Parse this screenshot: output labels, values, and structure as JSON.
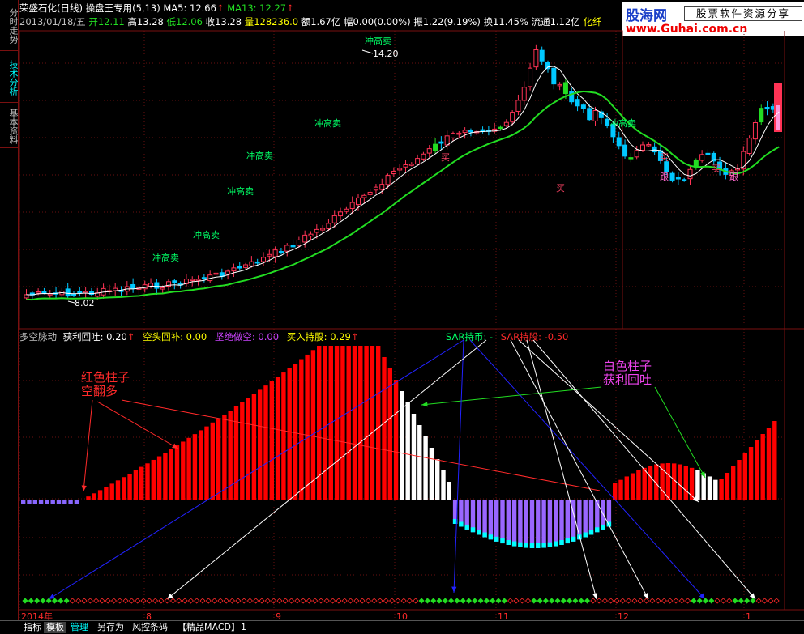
{
  "sidebar": {
    "tabs": [
      {
        "label": "分时走势",
        "active": false
      },
      {
        "label": "技术分析",
        "active": true
      },
      {
        "label": "基本资料",
        "active": false
      }
    ]
  },
  "info_bar": {
    "stock_name": "荣盛石化(日线)",
    "indicator_name": "操盘王专用(5,13)",
    "ma5": "MA5: 12.66",
    "ma13": "MA13: 12.27",
    "date": "2013/01/18/五",
    "open": "开12.11",
    "high": "高13.28",
    "low": "低12.06",
    "close": "收13.28",
    "volume": "量128236.0",
    "amount": "额1.67亿",
    "change": "幅0.00(0.00%)",
    "amplitude": "振1.22(9.19%)",
    "turnover": "换11.45%",
    "float": "流通1.12亿",
    "industry": "化纤"
  },
  "logo": {
    "brand_cn": "股海网",
    "tagline": "股票软件资源分享",
    "url": "www.Guhai.com.cn"
  },
  "main_chart": {
    "signal_buy": "买",
    "signal_sell_high": "冲高卖",
    "signal_follow": "跟",
    "high_label": "14.20",
    "low_label": "8.02",
    "colors": {
      "up": "#ff3355",
      "down": "#00c8ff",
      "ma5": "#ffffff",
      "ma13": "#22dd22",
      "signal": "#00ff66"
    }
  },
  "sub_chart": {
    "title": "多空脉动",
    "vals": [
      {
        "label": "获利回吐: 0.20",
        "color": "#ffffff"
      },
      {
        "label": "空头回补: 0.00",
        "color": "#ffff00"
      },
      {
        "label": "坚绝做空: 0.00",
        "color": "#cc44ff"
      },
      {
        "label": "买入持股: 0.29",
        "color": "#ffff00"
      }
    ],
    "sar_label": "SAR持币: -",
    "sar_hold": "SAR持股: -0.50",
    "annotation_red": [
      "红色柱子",
      "空翻多"
    ],
    "annotation_white": [
      "白色柱子",
      "获利回吐"
    ]
  },
  "x_axis": {
    "labels": [
      "2014年",
      "8",
      "9",
      "10",
      "11",
      "12",
      "1"
    ]
  },
  "bottom_tabs": [
    {
      "label": "指标",
      "active": false,
      "cyan": false
    },
    {
      "label": "模板",
      "active": true,
      "cyan": false
    },
    {
      "label": "管理",
      "active": false,
      "cyan": true
    },
    {
      "label": "另存为",
      "active": false,
      "cyan": false
    },
    {
      "label": "风控条码",
      "active": false,
      "cyan": false
    },
    {
      "label": "【精品MACD】",
      "active": false,
      "cyan": false
    },
    {
      "label": "1",
      "active": false,
      "cyan": false
    }
  ],
  "chart_data": {
    "type": "candlestick",
    "title": "荣盛石化(日线)",
    "price_range": [
      8.02,
      14.2
    ],
    "series": [
      {
        "name": "MA5",
        "values": [
          12.66
        ]
      },
      {
        "name": "MA13",
        "values": [
          12.27
        ]
      }
    ]
  }
}
